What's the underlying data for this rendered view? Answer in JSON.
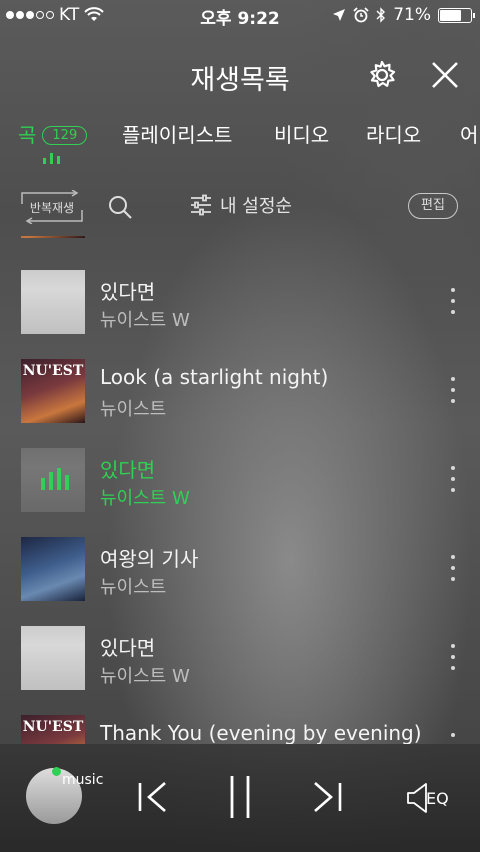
{
  "status_bar": {
    "carrier": "KT",
    "time": "오후 9:22",
    "battery": "71%",
    "battery_level": 0.71
  },
  "header": {
    "title": "재생목록"
  },
  "tabs": [
    {
      "label": "곡",
      "badge": "129",
      "active": true
    },
    {
      "label": "플레이리스트"
    },
    {
      "label": "비디오"
    },
    {
      "label": "라디오"
    },
    {
      "label": "어"
    }
  ],
  "toolbar": {
    "repeat_label": "반복재생",
    "sort_label": "내 설정순",
    "edit_label": "편집"
  },
  "tracks": [
    {
      "title": "있다면",
      "artist": "뉴이스트 W",
      "playing": false
    },
    {
      "title": "Look (a starlight night)",
      "artist": "뉴이스트",
      "playing": false
    },
    {
      "title": "있다면",
      "artist": "뉴이스트 W",
      "playing": true
    },
    {
      "title": "여왕의 기사",
      "artist": "뉴이스트",
      "playing": false
    },
    {
      "title": "있다면",
      "artist": "뉴이스트 W",
      "playing": false
    },
    {
      "title": "Thank You (evening by evening)",
      "artist": "",
      "playing": false
    }
  ],
  "album_text": {
    "nuest": "NU'EST"
  },
  "player": {
    "app_label": "music",
    "eq_label": "EQ"
  },
  "colors": {
    "accent": "#2fd053",
    "text": "#ffffff",
    "muted": "#bdbdbd"
  }
}
